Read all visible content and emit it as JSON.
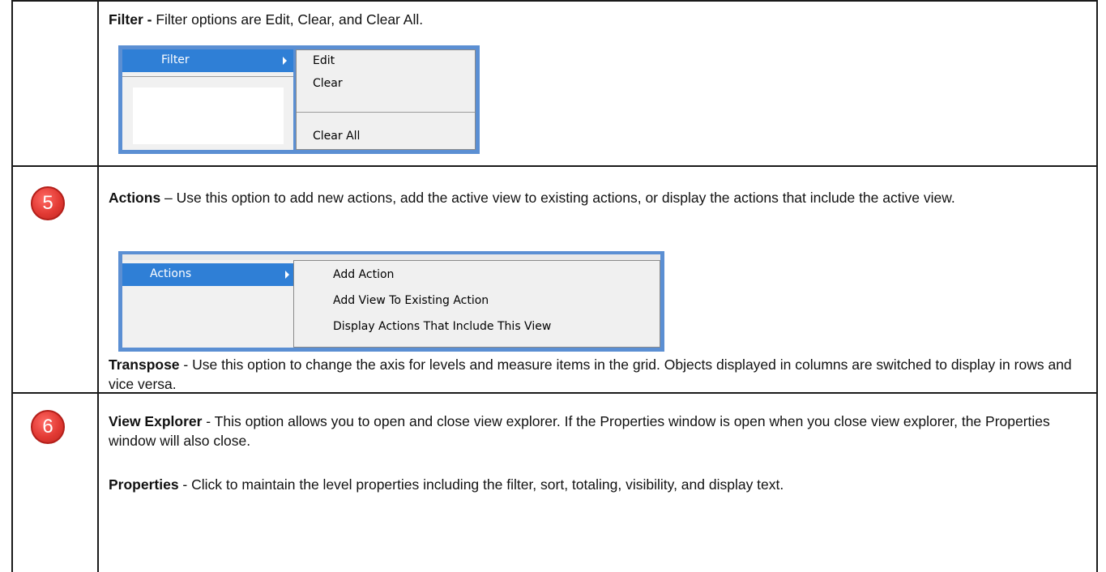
{
  "filter_section": {
    "heading": "Filter -",
    "text": " Filter options are Edit, Clear, and Clear All.",
    "menu": {
      "item": "Filter",
      "submenu": [
        "Edit",
        "Clear",
        "Clear All"
      ]
    }
  },
  "actions_section": {
    "badge": "5",
    "heading": "Actions",
    "text": " – Use this option to add new actions, add the active view to existing actions, or display the actions that include the active view.",
    "menu": {
      "item": "Actions",
      "submenu": [
        "Add Action",
        "Add View To Existing Action",
        "Display Actions That Include This View"
      ]
    },
    "transpose_heading": "Transpose",
    "transpose_text": " - Use this option to change the axis for levels and measure items in the grid. Objects displayed in columns are switched to display in rows and vice versa."
  },
  "view_section": {
    "badge": "6",
    "explorer_heading": "View Explorer",
    "explorer_text": " - This option allows you to open and close view explorer. If the Properties window is open when you close view explorer, the Properties window will also close.",
    "properties_heading": "Properties",
    "properties_text": " - Click to maintain the level properties including the filter, sort, totaling, visibility, and display text."
  },
  "colors": {
    "badge_red": "#e23a34",
    "menu_highlight": "#2f7fd6",
    "menu_border": "#5b8fd3"
  }
}
